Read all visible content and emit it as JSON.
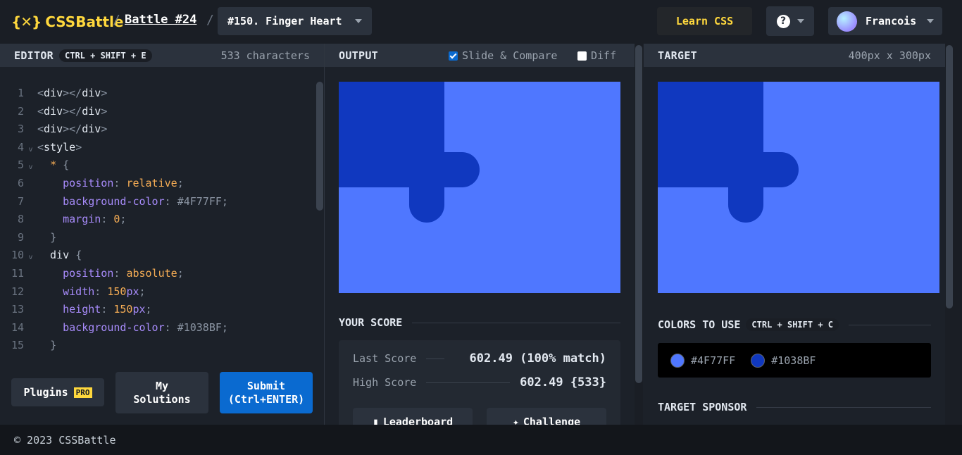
{
  "header": {
    "logo": "CSSBattle",
    "logo_mark": "{✕}",
    "separator": "/",
    "battle": "Battle #24",
    "level": "#150. Finger Heart",
    "learn_css": "Learn CSS",
    "help": "?",
    "user": "Francois"
  },
  "editor": {
    "title": "EDITOR",
    "shortcut": "CTRL + SHIFT + E",
    "char_count": "533 characters",
    "lines": [
      {
        "n": "1",
        "fold": "",
        "parts": [
          [
            "t-punc",
            "<"
          ],
          [
            "t-tag",
            "div"
          ],
          [
            "t-punc",
            "></"
          ],
          [
            "t-tag",
            "div"
          ],
          [
            "t-punc",
            ">"
          ]
        ]
      },
      {
        "n": "2",
        "fold": "",
        "parts": [
          [
            "t-punc",
            "<"
          ],
          [
            "t-tag",
            "div"
          ],
          [
            "t-punc",
            "></"
          ],
          [
            "t-tag",
            "div"
          ],
          [
            "t-punc",
            ">"
          ]
        ]
      },
      {
        "n": "3",
        "fold": "",
        "parts": [
          [
            "t-punc",
            "<"
          ],
          [
            "t-tag",
            "div"
          ],
          [
            "t-punc",
            "></"
          ],
          [
            "t-tag",
            "div"
          ],
          [
            "t-punc",
            ">"
          ]
        ]
      },
      {
        "n": "4",
        "fold": "v",
        "parts": [
          [
            "t-punc",
            "<"
          ],
          [
            "t-tag",
            "style"
          ],
          [
            "t-punc",
            ">"
          ]
        ]
      },
      {
        "n": "5",
        "fold": "v",
        "parts": [
          [
            "t-tag",
            "  "
          ],
          [
            "t-sel",
            "*"
          ],
          [
            "t-tag",
            " "
          ],
          [
            "t-punc",
            "{"
          ]
        ]
      },
      {
        "n": "6",
        "fold": "",
        "parts": [
          [
            "t-tag",
            "    "
          ],
          [
            "t-prop",
            "position"
          ],
          [
            "t-punc",
            ": "
          ],
          [
            "t-val",
            "relative"
          ],
          [
            "t-punc",
            ";"
          ]
        ]
      },
      {
        "n": "7",
        "fold": "",
        "parts": [
          [
            "t-tag",
            "    "
          ],
          [
            "t-prop",
            "background-color"
          ],
          [
            "t-punc",
            ": "
          ],
          [
            "t-hex",
            "#4F77FF"
          ],
          [
            "t-punc",
            ";"
          ]
        ]
      },
      {
        "n": "8",
        "fold": "",
        "parts": [
          [
            "t-tag",
            "    "
          ],
          [
            "t-prop",
            "margin"
          ],
          [
            "t-punc",
            ": "
          ],
          [
            "t-val",
            "0"
          ],
          [
            "t-punc",
            ";"
          ]
        ]
      },
      {
        "n": "9",
        "fold": "",
        "parts": [
          [
            "t-tag",
            "  "
          ],
          [
            "t-punc",
            "}"
          ]
        ]
      },
      {
        "n": "10",
        "fold": "v",
        "parts": [
          [
            "t-tag",
            "  div "
          ],
          [
            "t-punc",
            "{"
          ]
        ]
      },
      {
        "n": "11",
        "fold": "",
        "parts": [
          [
            "t-tag",
            "    "
          ],
          [
            "t-prop",
            "position"
          ],
          [
            "t-punc",
            ": "
          ],
          [
            "t-val",
            "absolute"
          ],
          [
            "t-punc",
            ";"
          ]
        ]
      },
      {
        "n": "12",
        "fold": "",
        "parts": [
          [
            "t-tag",
            "    "
          ],
          [
            "t-prop",
            "width"
          ],
          [
            "t-punc",
            ": "
          ],
          [
            "t-val",
            "150"
          ],
          [
            "t-prop",
            "px"
          ],
          [
            "t-punc",
            ";"
          ]
        ]
      },
      {
        "n": "13",
        "fold": "",
        "parts": [
          [
            "t-tag",
            "    "
          ],
          [
            "t-prop",
            "height"
          ],
          [
            "t-punc",
            ": "
          ],
          [
            "t-val",
            "150"
          ],
          [
            "t-prop",
            "px"
          ],
          [
            "t-punc",
            ";"
          ]
        ]
      },
      {
        "n": "14",
        "fold": "",
        "parts": [
          [
            "t-tag",
            "    "
          ],
          [
            "t-prop",
            "background-color"
          ],
          [
            "t-punc",
            ": "
          ],
          [
            "t-hex",
            "#1038BF"
          ],
          [
            "t-punc",
            ";"
          ]
        ]
      },
      {
        "n": "15",
        "fold": "",
        "parts": [
          [
            "t-tag",
            "  "
          ],
          [
            "t-punc",
            "}"
          ]
        ]
      }
    ],
    "plugins": "Plugins",
    "pro": "PRO",
    "my_solutions": "My Solutions",
    "submit": "Submit (Ctrl+ENTER)"
  },
  "output": {
    "title": "OUTPUT",
    "slide_compare": "Slide & Compare",
    "slide_compare_checked": true,
    "diff": "Diff",
    "diff_checked": false,
    "your_score": "YOUR SCORE",
    "last_score_label": "Last Score",
    "last_score": "602.49 (100% match)",
    "high_score_label": "High Score",
    "high_score": "602.49 {533}",
    "leaderboard": "Leaderboard",
    "challenge": "Challenge"
  },
  "target": {
    "title": "TARGET",
    "dims": "400px x 300px",
    "colors_title": "COLORS TO USE",
    "colors_shortcut": "CTRL + SHIFT + C",
    "colors": [
      "#4F77FF",
      "#1038BF"
    ],
    "sponsor_title": "TARGET SPONSOR"
  },
  "palette": {
    "bg": "#4f77ff",
    "fg": "#1038bf",
    "accent": "#ffd83d",
    "primary": "#0a6ad0"
  },
  "footer": {
    "copyright": "© 2023 CSSBattle"
  }
}
